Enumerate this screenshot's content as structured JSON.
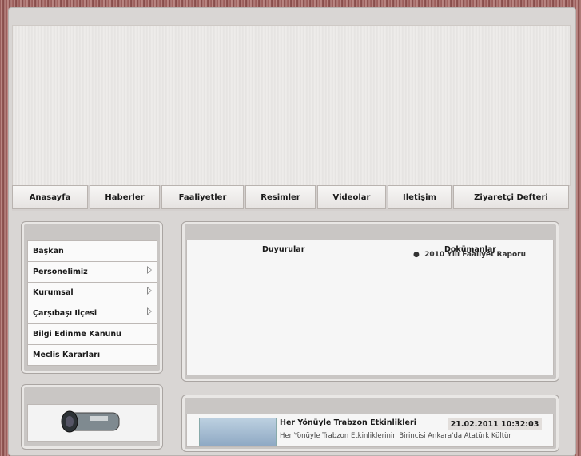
{
  "nav": [
    "Anasayfa",
    "Haberler",
    "Faaliyetler",
    "Resimler",
    "Videolar",
    "Iletişim",
    "Ziyaretçi Defteri"
  ],
  "menu": [
    {
      "label": "Başkan",
      "submenu": false
    },
    {
      "label": "Personelimiz",
      "submenu": true
    },
    {
      "label": "Kurumsal",
      "submenu": true
    },
    {
      "label": "Çarşıbaşı Ilçesi",
      "submenu": true
    },
    {
      "label": "Bilgi Edinme Kanunu",
      "submenu": false
    },
    {
      "label": "Meclis Kararları",
      "submenu": false
    }
  ],
  "announcements": {
    "duyurular_title": "Duyurular",
    "dokumanlar_title": "Dokümanlar",
    "doc_item": "2010 Yılı Faaliyet Raporu"
  },
  "news": {
    "title": "Her Yönüyle Trabzon Etkinlikleri",
    "date": "21.02.2011 10:32:03",
    "snippet": "Her Yönüyle Trabzon Etkinliklerinin Birincisi Ankara'da Atatürk Kültür"
  },
  "colors": {
    "nav_text": "#1a1a1a",
    "panel": "#c9c6c4"
  }
}
